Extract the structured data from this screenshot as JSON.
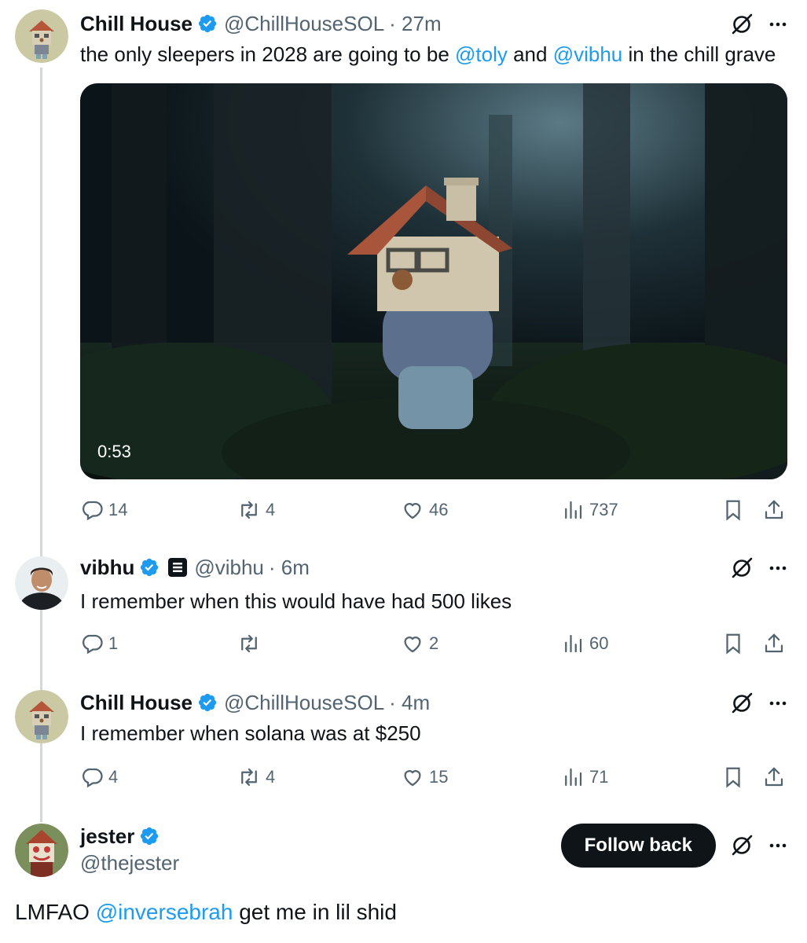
{
  "tweets": [
    {
      "name": "Chill House",
      "handle": "@ChillHouseSOL",
      "time": "· 27m",
      "text_parts": [
        "the only sleepers in 2028 are going to be ",
        "@toly",
        " and ",
        "@vibhu",
        " in the chill grave"
      ],
      "media": {
        "duration": "0:53"
      },
      "stats": {
        "replies": "14",
        "reposts": "4",
        "likes": "46",
        "views": "737"
      }
    },
    {
      "name": "vibhu",
      "handle": "@vibhu",
      "time": "· 6m",
      "text": "I remember when this would have had 500 likes",
      "stats": {
        "replies": "1",
        "reposts": "",
        "likes": "2",
        "views": "60"
      }
    },
    {
      "name": "Chill House",
      "handle": "@ChillHouseSOL",
      "time": "· 4m",
      "text": "I remember when solana was at $250",
      "stats": {
        "replies": "4",
        "reposts": "4",
        "likes": "15",
        "views": "71"
      }
    }
  ],
  "focus_tweet": {
    "name": "jester",
    "handle": "@thejester",
    "follow_label": "Follow back",
    "text_parts": [
      "LMFAO ",
      "@inversebrah",
      " get me in lil shid"
    ]
  },
  "colors": {
    "accent": "#1d9bf0",
    "text": "#0f1419",
    "secondary": "#536471",
    "thread_line": "#cfd9de"
  }
}
